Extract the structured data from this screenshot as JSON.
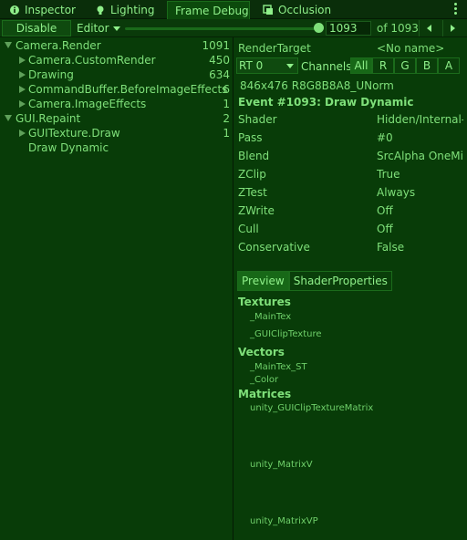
{
  "tabs": [
    {
      "label": "Inspector",
      "icon": "info-icon"
    },
    {
      "label": "Lighting",
      "icon": "bulb-icon"
    },
    {
      "label": "Frame Debug",
      "icon": ""
    },
    {
      "label": "Occlusion",
      "icon": "occlusion-icon"
    }
  ],
  "toolbar": {
    "disable_label": "Disable",
    "editor_label": "Editor",
    "slider_fraction": 1.0,
    "event_value": "1093",
    "of_label": "of 1093"
  },
  "tree": [
    {
      "label": "Camera.Render",
      "count": "1091",
      "depth": 0,
      "arrow": "down"
    },
    {
      "label": "Camera.CustomRender",
      "count": "450",
      "depth": 1,
      "arrow": "right"
    },
    {
      "label": "Drawing",
      "count": "634",
      "depth": 1,
      "arrow": "right"
    },
    {
      "label": "CommandBuffer.BeforeImageEffects",
      "count": "6",
      "depth": 1,
      "arrow": "right"
    },
    {
      "label": "Camera.ImageEffects",
      "count": "1",
      "depth": 1,
      "arrow": "right"
    },
    {
      "label": "GUI.Repaint",
      "count": "2",
      "depth": 0,
      "arrow": "down"
    },
    {
      "label": "GUITexture.Draw",
      "count": "1",
      "depth": 1,
      "arrow": "right"
    },
    {
      "label": "Draw Dynamic",
      "count": "",
      "depth": 1,
      "arrow": "none"
    }
  ],
  "render_target": {
    "label": "RenderTarget",
    "value": "<No name>",
    "rt_select": "RT 0",
    "channels_label": "Channels",
    "channels": [
      "All",
      "R",
      "G",
      "B",
      "A"
    ],
    "format": "846x476 R8G8B8A8_UNorm",
    "event_title": "Event #1093: Draw Dynamic"
  },
  "properties": [
    {
      "name": "Shader",
      "value": "Hidden/Internal-"
    },
    {
      "name": "Pass",
      "value": "#0"
    },
    {
      "name": "Blend",
      "value": "SrcAlpha OneMir"
    },
    {
      "name": "ZClip",
      "value": "True"
    },
    {
      "name": "ZTest",
      "value": "Always"
    },
    {
      "name": "ZWrite",
      "value": "Off"
    },
    {
      "name": "Cull",
      "value": "Off"
    },
    {
      "name": "Conservative",
      "value": "False"
    }
  ],
  "preview_tabs": [
    "Preview",
    "ShaderProperties"
  ],
  "shader_props": {
    "textures_title": "Textures",
    "textures": [
      "_MainTex",
      "_GUIClipTexture"
    ],
    "vectors_title": "Vectors",
    "vectors": [
      "_MainTex_ST",
      "_Color"
    ],
    "matrices_title": "Matrices",
    "matrices": [
      "unity_GUIClipTextureMatrix",
      "unity_MatrixV",
      "unity_MatrixVP"
    ]
  }
}
